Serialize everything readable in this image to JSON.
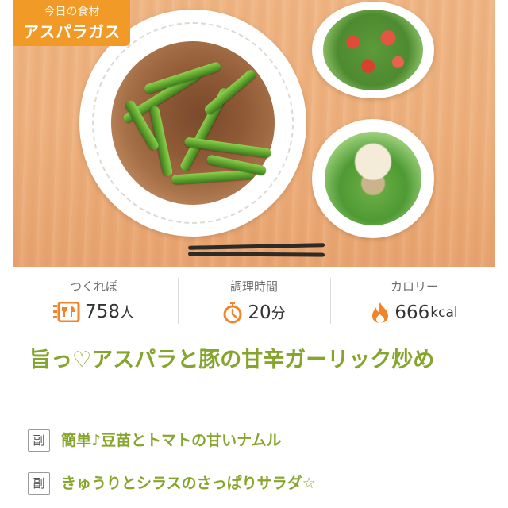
{
  "badge": {
    "subtitle": "今日の食材",
    "title": "アスパラガス"
  },
  "stats": [
    {
      "label": "つくれぽ",
      "value": "758",
      "unit": "人",
      "icon": "tsukurepo-icon"
    },
    {
      "label": "調理時間",
      "value": "20",
      "unit": "分",
      "icon": "stopwatch-icon"
    },
    {
      "label": "カロリー",
      "value": "666",
      "unit": "kcal",
      "icon": "flame-icon"
    }
  ],
  "recipe": {
    "title": "旨っ♡アスパラと豚の甘辛ガーリック炒め",
    "side_dishes": [
      {
        "tag": "副",
        "name": "簡単♪豆苗とトマトの甘いナムル"
      },
      {
        "tag": "副",
        "name": "きゅうりとシラスのさっぱりサラダ☆"
      }
    ]
  },
  "colors": {
    "accent_green": "#86a52d",
    "badge_orange": "#f29a27",
    "icon_orange": "#f0852b"
  }
}
